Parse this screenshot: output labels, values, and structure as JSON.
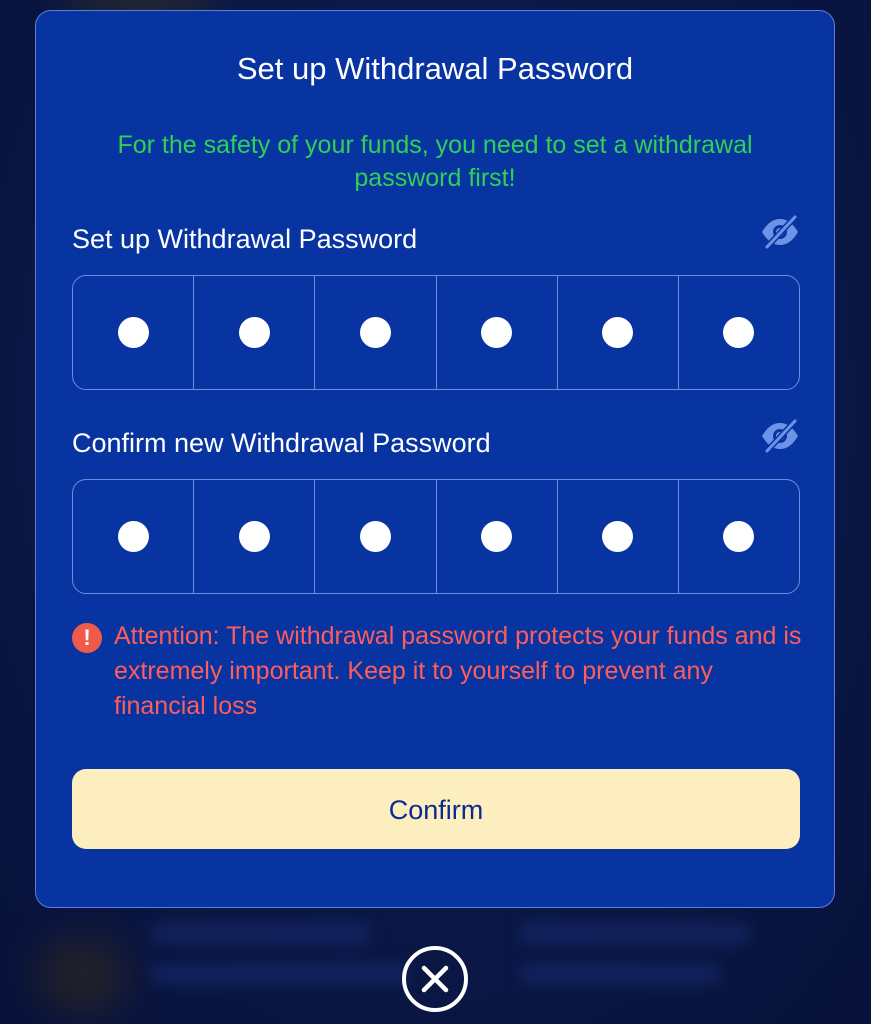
{
  "modal": {
    "title": "Set up Withdrawal Password",
    "subtitle": "For the safety of your funds, you need to set a withdrawal password first!",
    "password_field": {
      "label": "Set up Withdrawal Password",
      "digits_entered": 6,
      "visibility_icon": "eye-slash-icon"
    },
    "confirm_field": {
      "label": "Confirm new Withdrawal Password",
      "digits_entered": 6,
      "visibility_icon": "eye-slash-icon"
    },
    "attention": {
      "icon": "exclamation-circle-icon",
      "text": "Attention: The withdrawal password protects your funds and is extremely important. Keep it to yourself to prevent any financial loss"
    },
    "confirm_button_label": "Confirm",
    "close_icon": "close-circle-icon"
  },
  "colors": {
    "modal_background": "#0734a0",
    "subtitle_green": "#2ed158",
    "attention_red": "#ff5c5c",
    "button_cream": "#fdeebf",
    "button_text": "#0b2b8f"
  }
}
